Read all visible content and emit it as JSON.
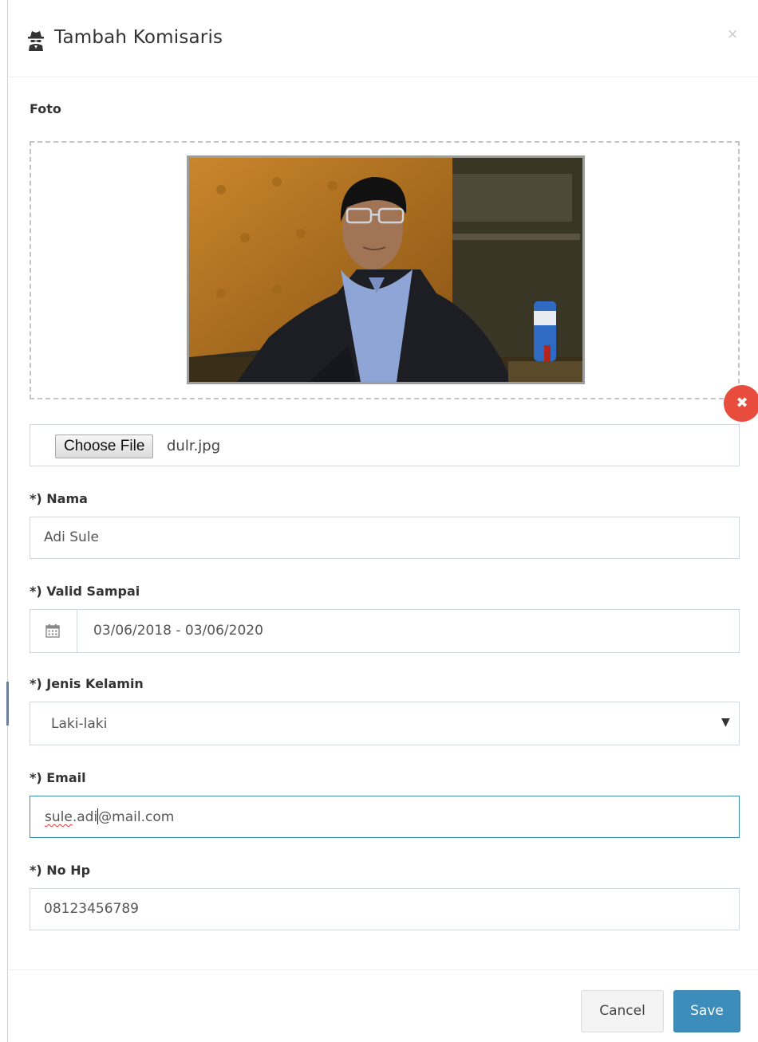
{
  "modal": {
    "title": "Tambah Komisaris",
    "close_label": "×"
  },
  "photo": {
    "label": "Foto",
    "remove_label": "✖",
    "choose_label": "Choose File",
    "file_name": "dulr.jpg"
  },
  "fields": {
    "nama": {
      "label": "*) Nama",
      "value": "Adi Sule"
    },
    "valid": {
      "label": "*) Valid Sampai",
      "value": "03/06/2018 - 03/06/2020",
      "icon": "calendar-icon"
    },
    "gender": {
      "label": "*) Jenis Kelamin",
      "value": "Laki-laki"
    },
    "email": {
      "label": "*) Email",
      "user_part": "sule",
      "middle_part": ".adi",
      "domain_part": "@mail.com"
    },
    "phone": {
      "label": "*) No Hp",
      "value": "08123456789"
    }
  },
  "footer": {
    "cancel_label": "Cancel",
    "save_label": "Save"
  },
  "colors": {
    "primary": "#3c8dbc",
    "danger": "#e74c3c",
    "border": "#d2d6de"
  }
}
